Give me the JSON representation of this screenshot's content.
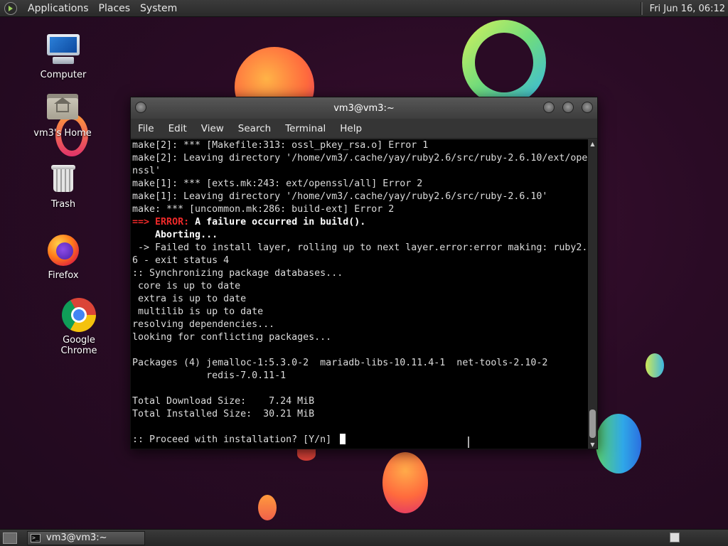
{
  "top_panel": {
    "menus": [
      "Applications",
      "Places",
      "System"
    ],
    "clock": "Fri Jun 16, 06:12"
  },
  "desktop_icons": [
    {
      "label": "Computer",
      "icon": "computer-icon"
    },
    {
      "label": "vm3's Home",
      "icon": "home-folder-icon"
    },
    {
      "label": "Trash",
      "icon": "trash-icon"
    },
    {
      "label": "Firefox",
      "icon": "firefox-icon"
    },
    {
      "label": "Google Chrome",
      "icon": "chrome-icon"
    }
  ],
  "window": {
    "title": "vm3@vm3:~",
    "menu": [
      "File",
      "Edit",
      "View",
      "Search",
      "Terminal",
      "Help"
    ]
  },
  "terminal": {
    "lines": [
      "make[2]: *** [Makefile:313: ossl_pkey_rsa.o] Error 1",
      "make[2]: Leaving directory '/home/vm3/.cache/yay/ruby2.6/src/ruby-2.6.10/ext/ope",
      "nssl'",
      "make[1]: *** [exts.mk:243: ext/openssl/all] Error 2",
      "make[1]: Leaving directory '/home/vm3/.cache/yay/ruby2.6/src/ruby-2.6.10'",
      "make: *** [uncommon.mk:286: build-ext] Error 2",
      "",
      "",
      " -> Failed to install layer, rolling up to next layer.error:error making: ruby2.",
      "6 - exit status 4",
      ":: Synchronizing package databases...",
      " core is up to date",
      " extra is up to date",
      " multilib is up to date",
      "resolving dependencies...",
      "looking for conflicting packages...",
      "",
      "Packages (4) jemalloc-1:5.3.0-2  mariadb-libs-10.11.4-1  net-tools-2.10-2",
      "             redis-7.0.11-1",
      "",
      "Total Download Size:    7.24 MiB",
      "Total Installed Size:  30.21 MiB",
      "",
      ":: Proceed with installation? [Y/n] "
    ],
    "error_arrow": "==>",
    "error_word": "ERROR:",
    "error_message": " A failure occurred in build().",
    "aborting": "    Aborting..."
  },
  "taskbar": {
    "task_label": "vm3@vm3:~"
  }
}
